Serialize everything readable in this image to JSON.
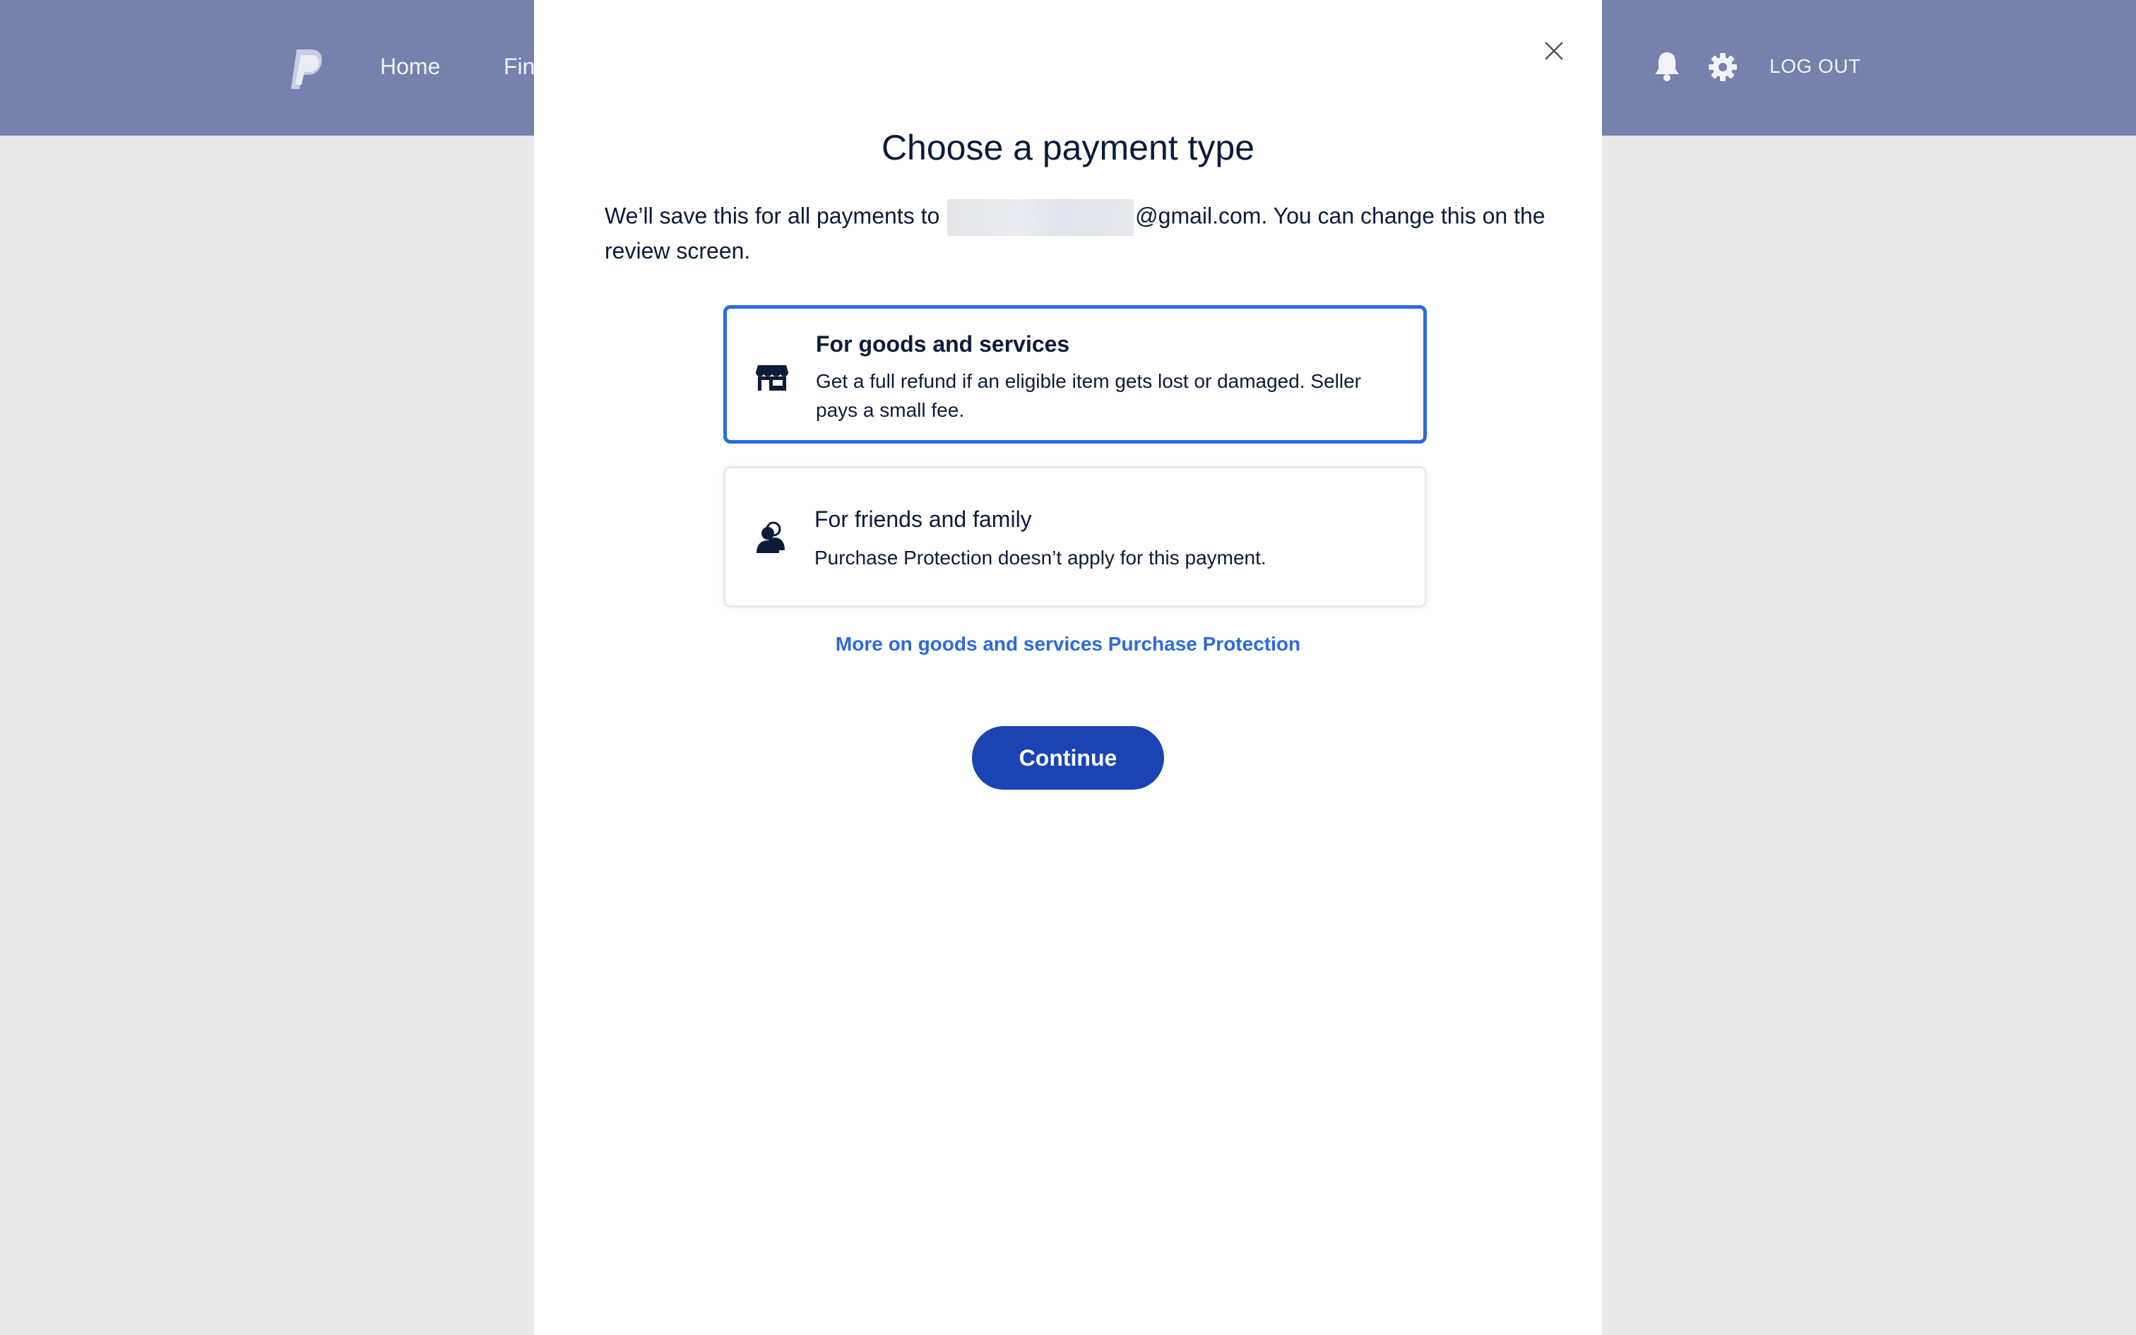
{
  "app": {
    "nav": {
      "home_label": "Home",
      "finance_label_partial": "Fin"
    },
    "logout_label": "LOG OUT",
    "icons": {
      "logo": "paypal-logo",
      "notifications": "bell-icon",
      "settings": "gear-icon"
    }
  },
  "modal": {
    "title": "Choose a payment type",
    "description_prefix": "We’ll save this for all payments to",
    "description_suffix": "@gmail.com. You can change this on the review screen.",
    "options": [
      {
        "title": "For goods and services",
        "text": "Get a full refund if an eligible item gets lost or damaged. Seller pays a small fee.",
        "icon": "store-icon",
        "selected": true
      },
      {
        "title": "For friends and family",
        "text": "Purchase Protection doesn’t apply for this payment.",
        "icon": "people-icon",
        "selected": false
      }
    ],
    "more_link": "More on goods and services Purchase Protection",
    "continue_label": "Continue"
  },
  "colors": {
    "header_bg": "#7681ad",
    "page_bg": "#e8e8e8",
    "selected_border": "#2b6ae0",
    "link": "#2b6ae0",
    "button_bg": "#1b44b3",
    "text": "#0c1b3a"
  }
}
